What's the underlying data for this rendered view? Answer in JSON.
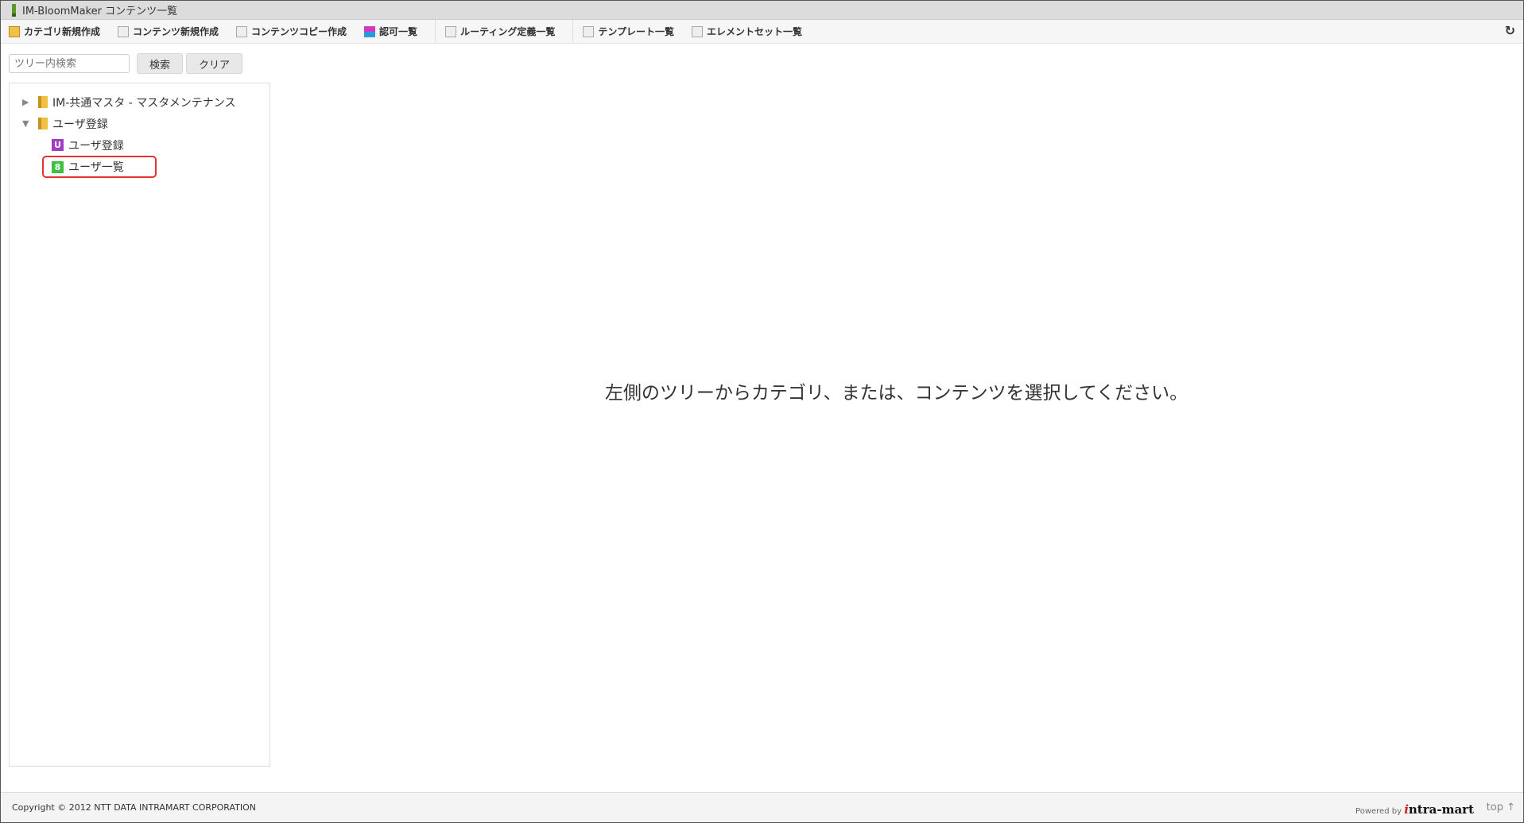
{
  "title": "IM-BloomMaker コンテンツ一覧",
  "toolbar": [
    {
      "label": "カテゴリ新規作成",
      "icon": "category-new-icon"
    },
    {
      "label": "コンテンツ新規作成",
      "icon": "content-new-icon"
    },
    {
      "label": "コンテンツコピー作成",
      "icon": "content-copy-icon"
    },
    {
      "label": "認可一覧",
      "icon": "authorization-icon"
    },
    {
      "label": "ルーティング定義一覧",
      "icon": "list-icon"
    },
    {
      "label": "テンプレート一覧",
      "icon": "list-icon"
    },
    {
      "label": "エレメントセット一覧",
      "icon": "list-icon"
    }
  ],
  "refresh_icon": "↻",
  "search": {
    "placeholder": "ツリー内検索",
    "search_label": "検索",
    "clear_label": "クリア"
  },
  "tree": {
    "n1": "IM-共通マスタ - マスタメンテナンス",
    "n2": "ユーザ登録",
    "n2a": {
      "badge": "U",
      "label": "ユーザ登録",
      "color": "#a040c0"
    },
    "n2b": {
      "badge": "8",
      "label": "ユーザ一覧",
      "color": "#40c040"
    }
  },
  "message": "左側のツリーからカテゴリ、または、コンテンツを選択してください。",
  "footer": {
    "copyright": "Copyright © 2012 NTT DATA INTRAMART CORPORATION",
    "powered": "Powered by",
    "brand": "intra-mart",
    "top": "top ↑"
  }
}
